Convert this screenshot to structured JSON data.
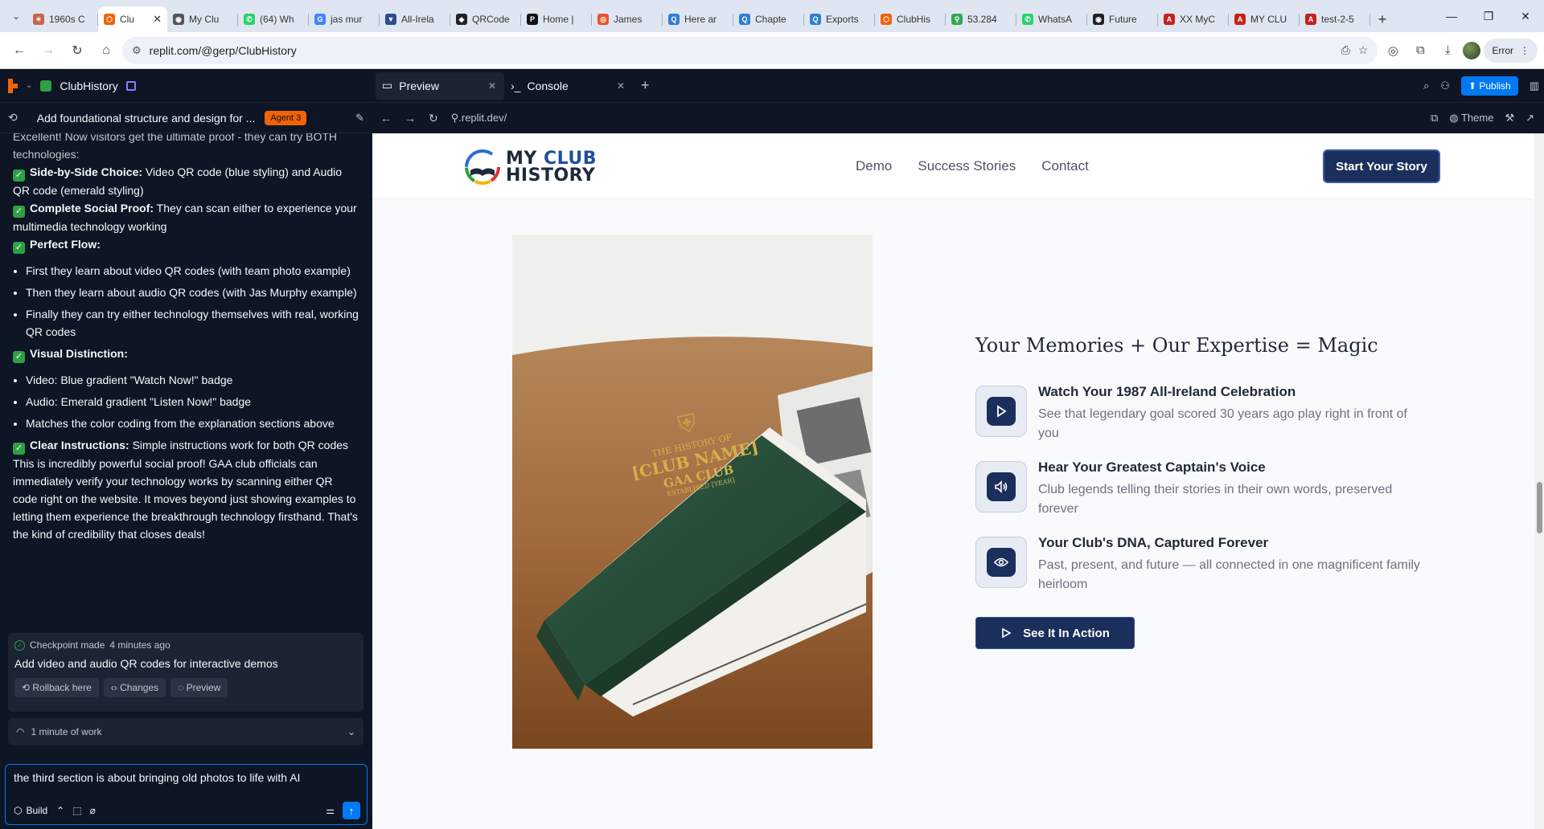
{
  "browser": {
    "tabs": [
      {
        "label": "1960s C",
        "color": "#c9644b",
        "glyph": "✶"
      },
      {
        "label": "Clu",
        "color": "#f26207",
        "glyph": "⬡",
        "active": true
      },
      {
        "label": "My Clu",
        "color": "#555555",
        "glyph": "◉"
      },
      {
        "label": "(64) Wh",
        "color": "#25d366",
        "glyph": "✆"
      },
      {
        "label": "jas mur",
        "color": "#4285f4",
        "glyph": "G"
      },
      {
        "label": "All-Irela",
        "color": "#2a4d8f",
        "glyph": "▼"
      },
      {
        "label": "QRCode",
        "color": "#222222",
        "glyph": "◈"
      },
      {
        "label": "Home |",
        "color": "#111111",
        "glyph": "P"
      },
      {
        "label": "James",
        "color": "#e8542c",
        "glyph": "◎"
      },
      {
        "label": "Here ar",
        "color": "#2f7fd1",
        "glyph": "Q"
      },
      {
        "label": "Chapte",
        "color": "#2f7fd1",
        "glyph": "Q"
      },
      {
        "label": "Exports",
        "color": "#2f7fd1",
        "glyph": "Q"
      },
      {
        "label": "ClubHis",
        "color": "#f26207",
        "glyph": "⬡"
      },
      {
        "label": "53.284",
        "color": "#34a853",
        "glyph": "⚲"
      },
      {
        "label": "WhatsA",
        "color": "#25d366",
        "glyph": "✆"
      },
      {
        "label": "Future",
        "color": "#222222",
        "glyph": "◉"
      },
      {
        "label": "XX MyC",
        "color": "#c5221f",
        "glyph": "A"
      },
      {
        "label": "MY CLU",
        "color": "#c5221f",
        "glyph": "A"
      },
      {
        "label": "test-2-5",
        "color": "#c5221f",
        "glyph": "A"
      }
    ],
    "url": "replit.com/@gerp/ClubHistory",
    "error_label": "Error"
  },
  "replit": {
    "project_name": "ClubHistory",
    "thread_title": "Add foundational structure and design for ...",
    "agent_badge": "Agent 3",
    "preview_tab": "Preview",
    "console_tab": "Console",
    "publish_label": "Publish",
    "preview_url": ".replit.dev/",
    "theme_label": "Theme"
  },
  "chat": {
    "intro": "Excellent! Now visitors get the ultimate proof - they can try BOTH technologies:",
    "p1_bold": "Side-by-Side Choice:",
    "p1_text": " Video QR code (blue styling) and Audio QR code (emerald styling)",
    "p2_bold": "Complete Social Proof:",
    "p2_text": " They can scan either to experience your multimedia technology working",
    "p3_bold": "Perfect Flow:",
    "flow": [
      "First they learn about video QR codes (with team photo example)",
      "Then they learn about audio QR codes (with Jas Murphy example)",
      "Finally they can try either technology themselves with real, working QR codes"
    ],
    "p4_bold": "Visual Distinction:",
    "distinction": [
      "Video: Blue gradient \"Watch Now!\" badge",
      "Audio: Emerald gradient \"Listen Now!\" badge",
      "Matches the color coding from the explanation sections above"
    ],
    "p5_bold": "Clear Instructions:",
    "p5_text": " Simple instructions work for both QR codes",
    "closing": "This is incredibly powerful social proof! GAA club officials can immediately verify your technology works by scanning either QR code right on the website. It moves beyond just showing examples to letting them experience the breakthrough technology firsthand. That's the kind of credibility that closes deals!",
    "checkpoint_label": "Checkpoint made",
    "checkpoint_time": "4 minutes ago",
    "checkpoint_title": "Add video and audio QR codes for interactive demos",
    "rollback_label": "Rollback here",
    "changes_label": "Changes",
    "preview_label": "Preview",
    "work_label": "1 minute of work",
    "input_value": "the third section is about bringing old photos to life with AI",
    "build_label": "Build"
  },
  "site": {
    "logo_line1": "MY ",
    "logo_line1b": "CLUB",
    "logo_line2": "HISTORY",
    "nav": [
      "Demo",
      "Success Stories",
      "Contact"
    ],
    "cta": "Start Your Story",
    "book_line1": "THE HISTORY OF",
    "book_line2": "[CLUB NAME]",
    "book_line3": "GAA CLUB",
    "book_line4": "ESTABLISED [YEAR]",
    "heading": "Your Memories + Our Expertise = Magic",
    "features": [
      {
        "title": "Watch Your 1987 All-Ireland Celebration",
        "desc": "See that legendary goal scored 30 years ago play right in front of you",
        "icon": "play-icon"
      },
      {
        "title": "Hear Your Greatest Captain's Voice",
        "desc": "Club legends telling their stories in their own words, preserved forever",
        "icon": "speaker-icon"
      },
      {
        "title": "Your Club's DNA, Captured Forever",
        "desc": "Past, present, and future — all connected in one magnificent family heirloom",
        "icon": "eye-icon"
      }
    ],
    "action_button": "See It In Action"
  }
}
